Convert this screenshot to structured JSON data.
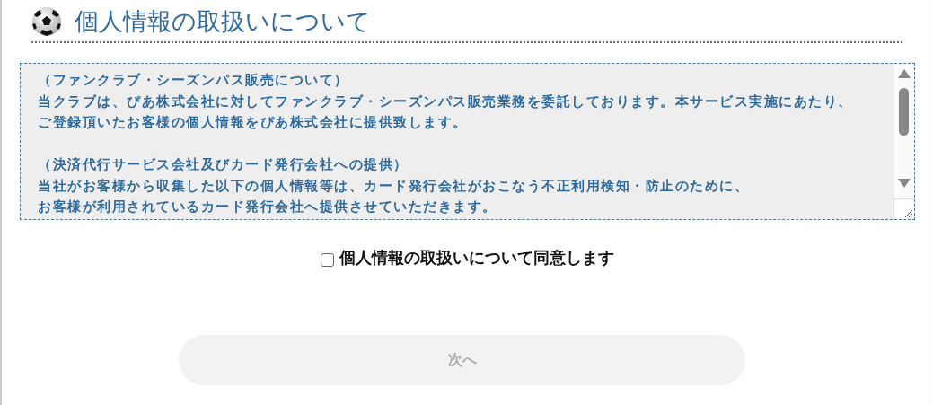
{
  "heading": {
    "title": "個人情報の取扱いについて"
  },
  "notice": {
    "sections": [
      {
        "heading": "（ファンクラブ・シーズンパス販売について）",
        "lines": [
          "当クラブは、ぴあ株式会社に対してファンクラブ・シーズンパス販売業務を委託しております。本サービス実施にあたり、",
          "ご登録頂いたお客様の個人情報をぴあ株式会社に提供致します。"
        ]
      },
      {
        "heading": "（決済代行サービス会社及びカード発行会社への提供）",
        "lines": [
          "当社がお客様から収集した以下の個人情報等は、カード発行会社がおこなう不正利用検知・防止のために、",
          "お客様が利用されているカード発行会社へ提供させていただきます。"
        ]
      }
    ]
  },
  "consent": {
    "label": "個人情報の取扱いについて同意します",
    "checked": false
  },
  "next_button": {
    "label": "次へ",
    "disabled": true
  }
}
